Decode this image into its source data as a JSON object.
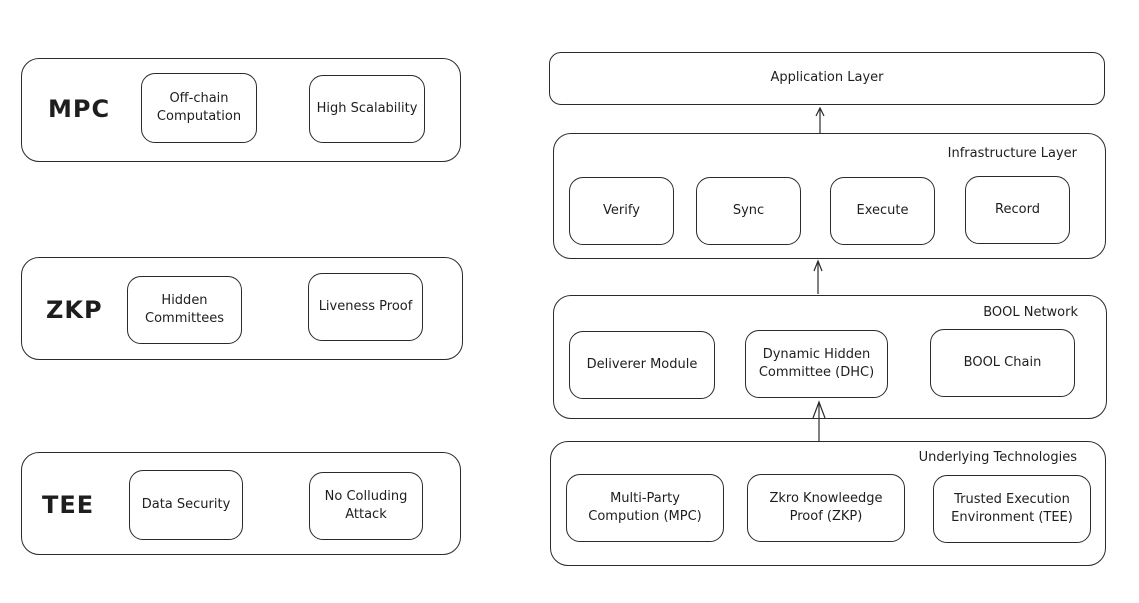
{
  "left_panel": {
    "technologies": [
      {
        "name": "MPC",
        "features": [
          "Off-chain Computation",
          "High Scalability"
        ]
      },
      {
        "name": "ZKP",
        "features": [
          "Hidden Committees",
          "Liveness Proof"
        ]
      },
      {
        "name": "TEE",
        "features": [
          "Data Security",
          "No Colluding Attack"
        ]
      }
    ]
  },
  "architecture": {
    "application_layer": {
      "title": "Application Layer"
    },
    "infrastructure_layer": {
      "title": "Infrastructure Layer",
      "modules": [
        "Verify",
        "Sync",
        "Execute",
        "Record"
      ]
    },
    "bool_network": {
      "title": "BOOL Network",
      "modules": [
        "Deliverer Module",
        "Dynamic Hidden Committee (DHC)",
        "BOOL Chain"
      ]
    },
    "underlying_technologies": {
      "title": "Underlying Technologies",
      "modules": [
        "Multi-Party Compution (MPC)",
        "Zkro Knowleedge Proof (ZKP)",
        "Trusted Execution Environment (TEE)"
      ]
    },
    "flow": [
      "Underlying Technologies",
      "BOOL Network",
      "Infrastructure Layer",
      "Application Layer"
    ]
  }
}
